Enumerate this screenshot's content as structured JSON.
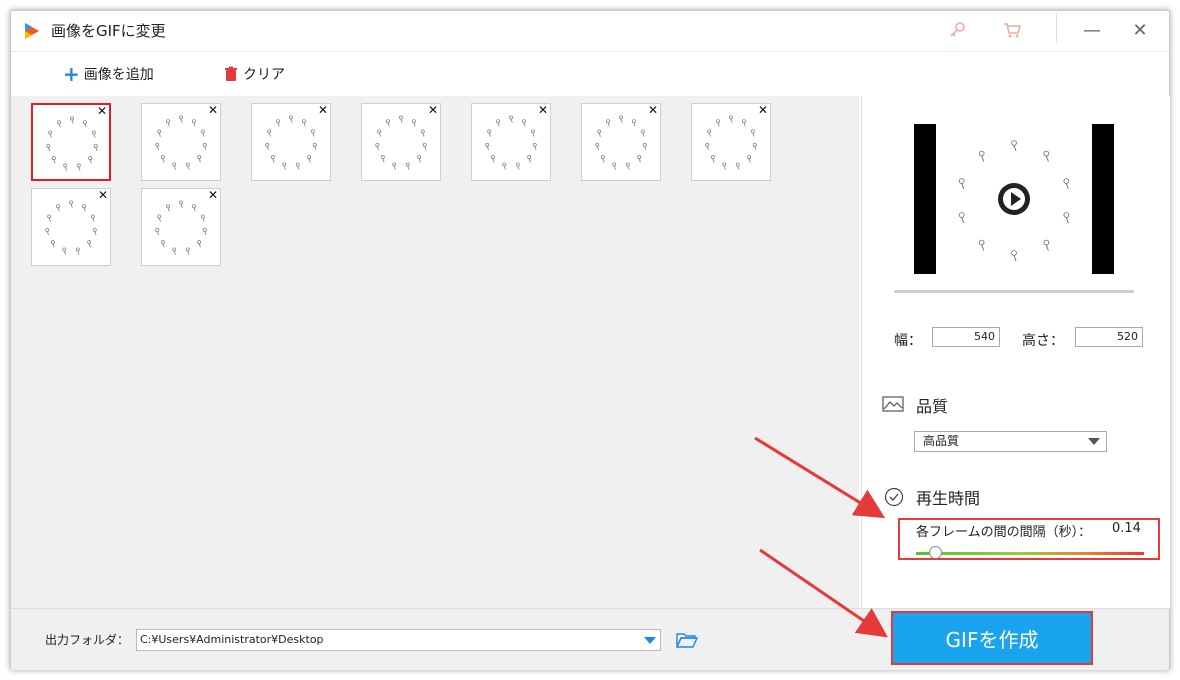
{
  "window": {
    "title": "画像をGIFに変更"
  },
  "icons": {
    "app_logo": "app-logo-icon",
    "key": "key-icon",
    "cart": "cart-icon",
    "minimize": "minimize-icon",
    "close": "close-icon"
  },
  "toolbar": {
    "add_label": "画像を追加",
    "clear_label": "クリア"
  },
  "thumbnails": {
    "count": 9,
    "selected_index": 0,
    "remove_glyph": "✕"
  },
  "preview": {
    "play_icon": "play-icon"
  },
  "size": {
    "width_label": "幅：",
    "width_value": "540",
    "height_label": "高さ：",
    "height_value": "520"
  },
  "quality": {
    "title": "品質",
    "selected": "高品質"
  },
  "playback": {
    "title": "再生時間",
    "interval_label": "各フレームの間の間隔（秒）：",
    "interval_value": "0.14"
  },
  "output": {
    "label": "出力フォルダ：",
    "path": "C:¥Users¥Administrator¥Desktop"
  },
  "create_button": {
    "label": "GIFを作成"
  },
  "colors": {
    "accent": "#1aa3ef",
    "highlight": "#e53a3a",
    "selection": "#e02020"
  }
}
